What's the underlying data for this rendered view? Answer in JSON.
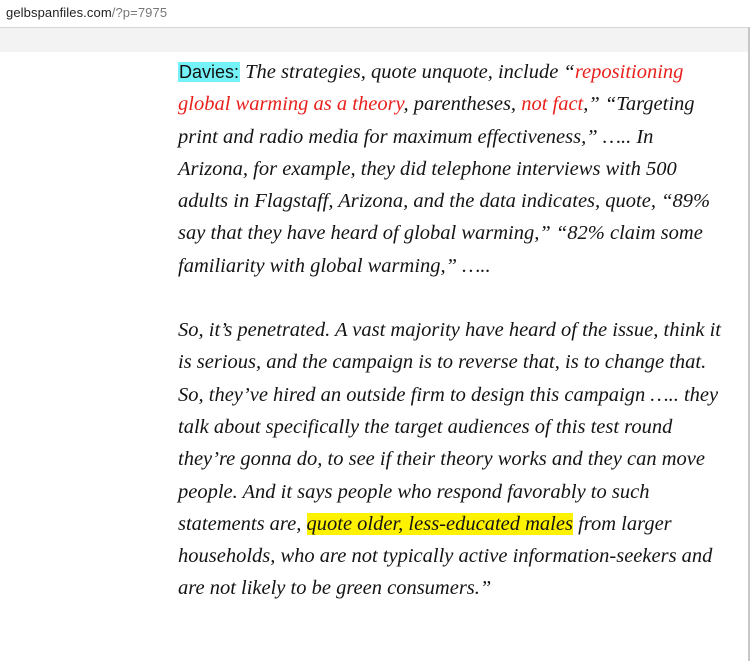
{
  "browser": {
    "url_domain": "gelbspanfiles.com",
    "url_path": "/?p=7975"
  },
  "article": {
    "speaker": "Davies:",
    "p1_a": " The strategies, quote unquote, include “",
    "p1_red1": "repositioning global warming as a theory",
    "p1_b": ", parentheses, ",
    "p1_red2": "not fact",
    "p1_c": ",” “Targeting print and radio media for maximum effectiveness,” ….. In Arizona, for example, they did telephone interviews with 500 adults in Flagstaff, Arizona, and the data indicates, quote, “89% say that they have heard of global warming,” “82% claim some familiarity with global warming,” …..",
    "p2_a": "So, it’s penetrated. A vast majority have heard of the issue, think it is serious, and the campaign is to reverse that, is to change that. So, they’ve hired an outside firm to design this campaign ….. they talk about specifically the target audiences of this test round they’re gonna do, to see if their theory works and they can move people. And it says people who respond favorably to such statements are, ",
    "p2_hl": "quote older, less-educated males",
    "p2_b": " from larger households, who are not typically active information-seekers and are not likely to be green consumers.”"
  },
  "colors": {
    "speaker_highlight": "#74f2f7",
    "quote_highlight": "#fff200",
    "emphasis_red": "#e8211c"
  }
}
